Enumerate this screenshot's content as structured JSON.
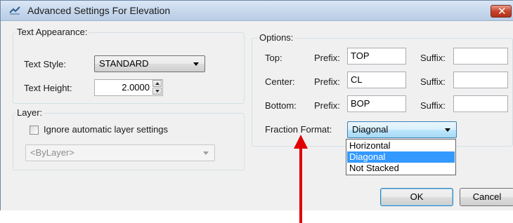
{
  "window": {
    "title": "Advanced Settings For Elevation",
    "close_glyph": "✕"
  },
  "text_appearance": {
    "group_label": "Text Appearance:",
    "style_label": "Text Style:",
    "style_value": "STANDARD",
    "height_label": "Text Height:",
    "height_value": "2.0000"
  },
  "layer": {
    "group_label": "Layer:",
    "ignore_label": "Ignore automatic layer settings",
    "ignore_checked": false,
    "layer_value": "<ByLayer>"
  },
  "options": {
    "group_label": "Options:",
    "rows": [
      {
        "label": "Top:",
        "prefix_label": "Prefix:",
        "prefix": "TOP",
        "suffix_label": "Suffix:",
        "suffix": ""
      },
      {
        "label": "Center:",
        "prefix_label": "Prefix:",
        "prefix": "CL",
        "suffix_label": "Suffix:",
        "suffix": ""
      },
      {
        "label": "Bottom:",
        "prefix_label": "Prefix:",
        "prefix": "BOP",
        "suffix_label": "Suffix:",
        "suffix": ""
      }
    ],
    "fraction_label": "Fraction Format:",
    "fraction_value": "Diagonal",
    "fraction_options": [
      "Horizontal",
      "Diagonal",
      "Not Stacked"
    ],
    "fraction_selected_index": 1
  },
  "buttons": {
    "ok": "OK",
    "cancel": "Cancel"
  },
  "colors": {
    "highlight": "#3399ff",
    "annotation_arrow": "#e00000"
  }
}
